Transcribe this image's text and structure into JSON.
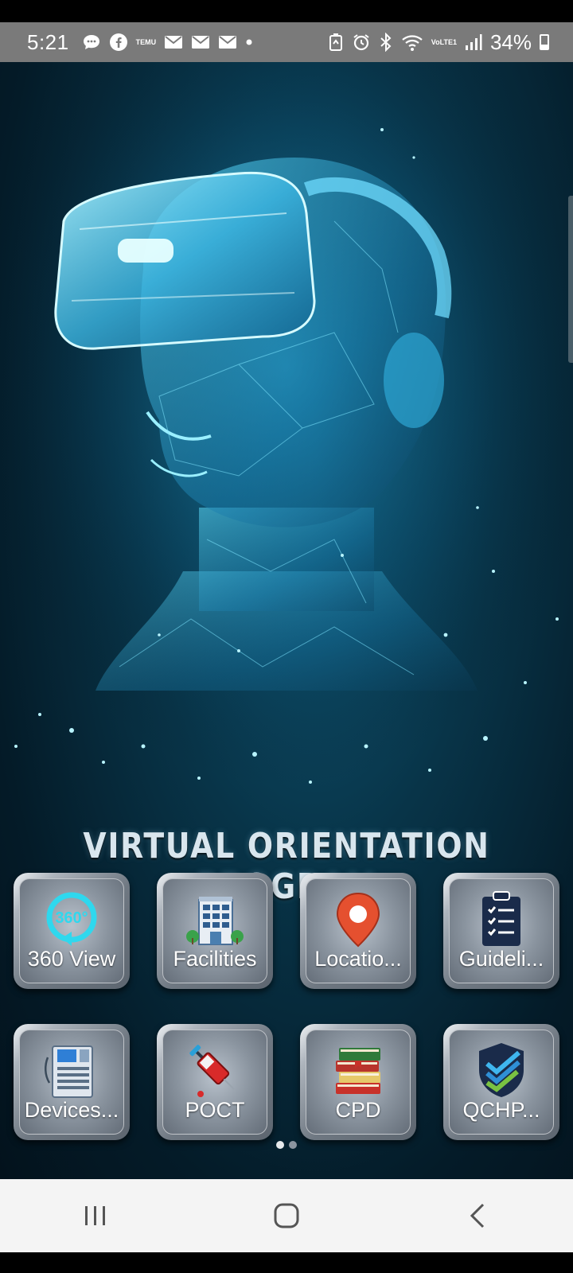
{
  "status_bar": {
    "time": "5:21",
    "battery_text": "34%",
    "temu_label": "TEMU",
    "volte_label": "VoLTE1",
    "icons": [
      "chat-bubble-icon",
      "facebook-icon",
      "temu-icon",
      "email-icon",
      "email-icon",
      "email-icon",
      "dot-icon",
      "recycle-icon",
      "alarm-icon",
      "bluetooth-icon",
      "wifi-icon",
      "volte-icon",
      "signal-icon",
      "battery-icon"
    ]
  },
  "banner": {
    "title": "VIRTUAL ORIENTATION PROGRAM"
  },
  "menu": {
    "tiles": [
      {
        "label": "360 View",
        "icon": "360-view-icon",
        "icon_text": "360°"
      },
      {
        "label": "Facilities",
        "icon": "building-icon"
      },
      {
        "label": "Locatio...",
        "icon": "location-pin-icon"
      },
      {
        "label": "Guideli...",
        "icon": "clipboard-icon"
      },
      {
        "label": "Devices...",
        "icon": "medical-device-icon"
      },
      {
        "label": "POCT",
        "icon": "syringe-icon"
      },
      {
        "label": "CPD",
        "icon": "books-icon"
      },
      {
        "label": "QCHP...",
        "icon": "shield-check-icon"
      }
    ]
  },
  "pager": {
    "pages": 2,
    "current": 1
  },
  "nav_bar": {
    "buttons": [
      "recent-apps-icon",
      "home-icon",
      "back-icon"
    ]
  },
  "colors": {
    "status_bar": "#7a7a7a",
    "background_dark": "#041b28",
    "glow_cyan": "#3fd4f5",
    "tile_gray": "#8a949f",
    "nav_bar": "#f4f4f4"
  }
}
